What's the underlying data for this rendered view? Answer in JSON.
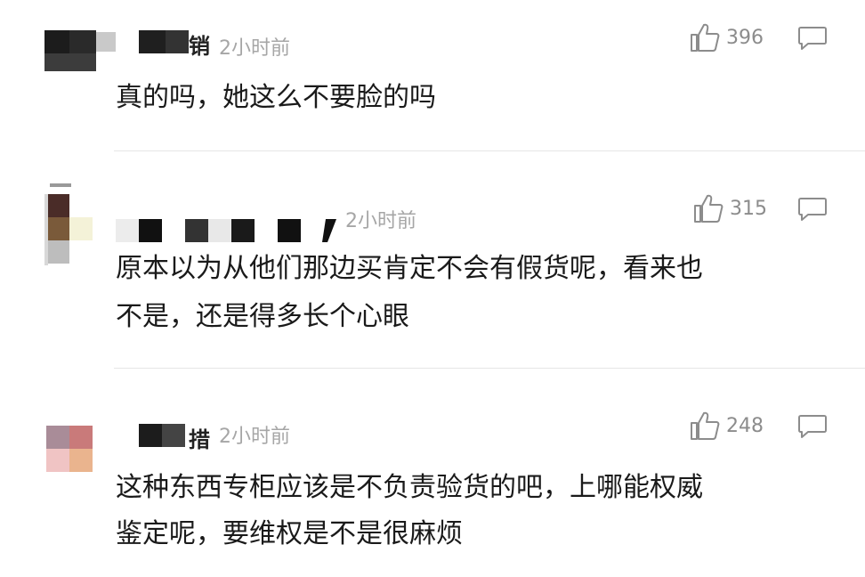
{
  "comments": [
    {
      "name_tail": "销",
      "time": "2小时前",
      "likes": "396",
      "lines": [
        "真的吗，她这么不要脸的吗"
      ]
    },
    {
      "name_tail": "",
      "time": "2小时前",
      "likes": "315",
      "lines": [
        "原本以为从他们那边买肯定不会有假货呢，看来也",
        "不是，还是得多长个心眼"
      ]
    },
    {
      "name_tail": "措",
      "time": "2小时前",
      "likes": "248",
      "lines": [
        "这种东西专柜应该是不负责验货的吧，上哪能权威",
        "鉴定呢，要维权是不是很麻烦"
      ]
    }
  ],
  "icons": {
    "like": "thumbs-up-icon",
    "reply": "comment-bubble-icon"
  },
  "colors": {
    "text": "#1a1a1a",
    "meta": "#a6a6a6",
    "icon": "#8c8c8c",
    "divider": "#e6e6e6"
  }
}
